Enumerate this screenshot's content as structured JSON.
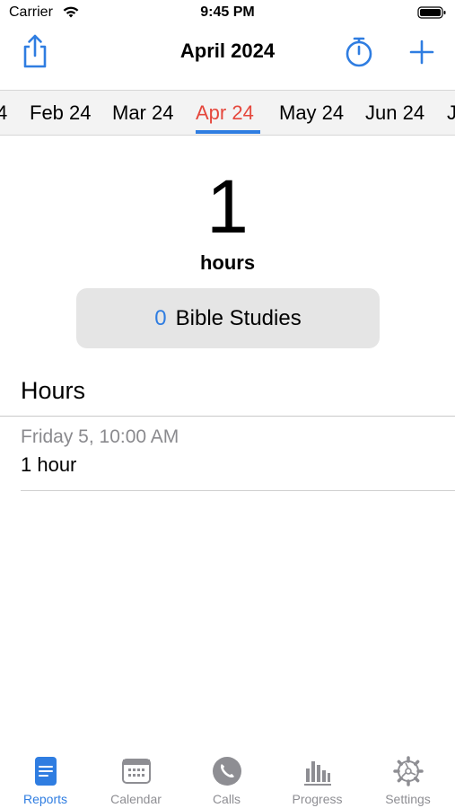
{
  "status_bar": {
    "carrier": "Carrier",
    "time": "9:45 PM"
  },
  "nav": {
    "title": "April 2024",
    "accent_color": "#2f7de1"
  },
  "months": {
    "items": [
      "4",
      "Feb 24",
      "Mar 24",
      "Apr 24",
      "May 24",
      "Jun 24",
      "J"
    ],
    "selected": "Apr 24",
    "selected_color": "#e5473c"
  },
  "summary": {
    "hours_value": "1",
    "hours_label": "hours",
    "bible_studies_count": "0",
    "bible_studies_label": "Bible Studies"
  },
  "hours_section": {
    "title": "Hours",
    "entries": [
      {
        "date": "Friday 5, 10:00 AM",
        "value": "1 hour"
      }
    ]
  },
  "tab_bar": {
    "tabs": [
      {
        "label": "Reports",
        "icon": "reports-icon",
        "active": true
      },
      {
        "label": "Calendar",
        "icon": "calendar-icon",
        "active": false
      },
      {
        "label": "Calls",
        "icon": "phone-icon",
        "active": false
      },
      {
        "label": "Progress",
        "icon": "bar-chart-icon",
        "active": false
      },
      {
        "label": "Settings",
        "icon": "gear-icon",
        "active": false
      }
    ]
  }
}
